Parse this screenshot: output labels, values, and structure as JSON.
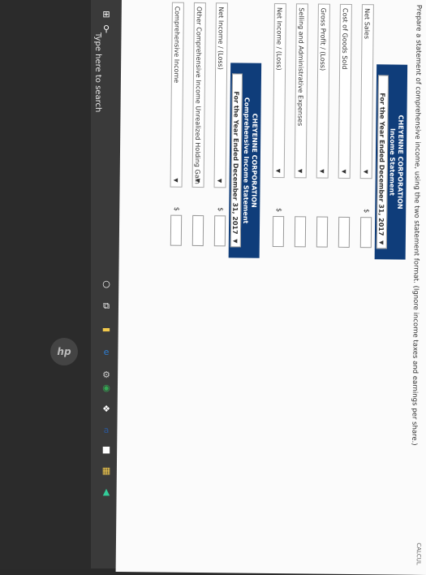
{
  "calc_label": "CALCUL",
  "prompt": "Prepare a statement of comprehensive income, using the two statement format. (Ignore income taxes and earnings per share.)",
  "income_statement": {
    "company": "CHEYENNE CORPORATION",
    "statement": "Income Statement",
    "period": "For the Year Ended December 31, 2017",
    "rows": [
      {
        "label": "Net Sales",
        "dollar": "$"
      },
      {
        "label": "Cost of Goods Sold",
        "dollar": ""
      },
      {
        "label": "Gross Profit / (Loss)",
        "dollar": ""
      },
      {
        "label": "Selling and Administrative Expenses",
        "dollar": ""
      },
      {
        "label": "Net Income / (Loss)",
        "dollar": "$"
      }
    ]
  },
  "comprehensive_statement": {
    "company": "CHEYENNE CORPORATION",
    "statement": "Comprehensive Income Statement",
    "period": "For the Year Ended December 31, 2017",
    "rows": [
      {
        "label": "Net Income / (Loss)",
        "dollar": "$"
      },
      {
        "label": "Other Comprehensive Income Unrealized Holding Gain",
        "dollar": ""
      },
      {
        "label": "Comprehensive Income",
        "dollar": "$"
      }
    ]
  },
  "taskbar": {
    "search_text": "Type here to search"
  },
  "laptop_logo": "hp"
}
